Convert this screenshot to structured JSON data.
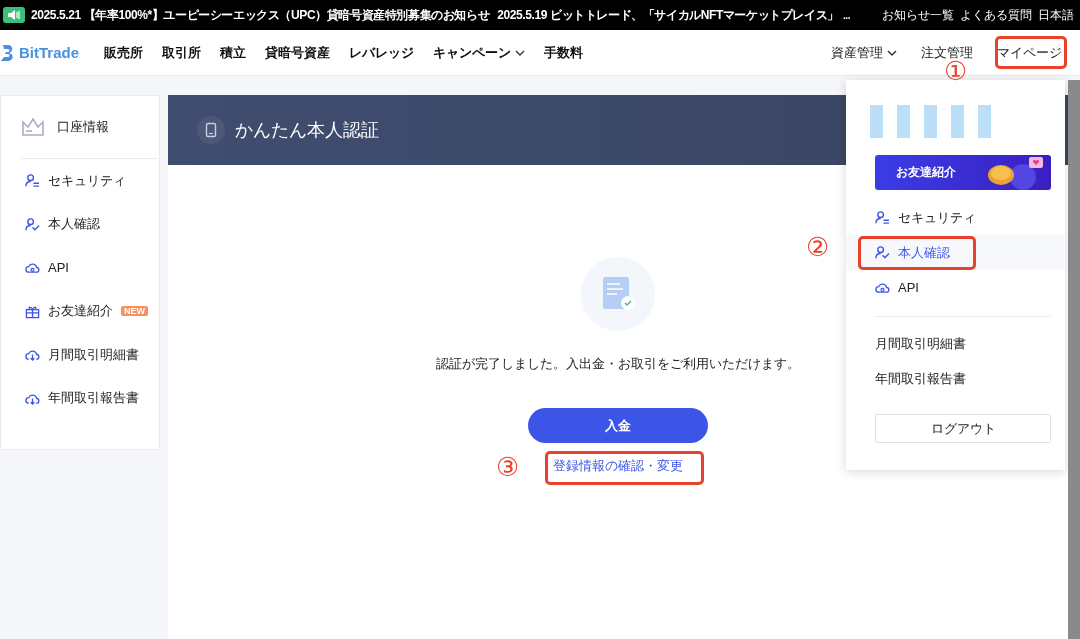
{
  "ticker": {
    "items": [
      {
        "date": "2025.5.21",
        "title": "【年率100%*】ユーピーシーエックス（UPC）貸暗号資産特別募集のお知らせ"
      },
      {
        "date": "2025.5.19",
        "title": "ビットトレード、「サイカルNFTマーケットプレイス」"
      }
    ],
    "overflow": "...",
    "links": [
      "お知らせ一覧",
      "よくある質問",
      "日本語"
    ]
  },
  "nav": {
    "logo": "BitTrade",
    "items": [
      {
        "label": "販売所",
        "dropdown": false
      },
      {
        "label": "取引所",
        "dropdown": false
      },
      {
        "label": "積立",
        "dropdown": false
      },
      {
        "label": "貸暗号資産",
        "dropdown": false
      },
      {
        "label": "レバレッジ",
        "dropdown": false
      },
      {
        "label": "キャンペーン",
        "dropdown": true
      },
      {
        "label": "手数料",
        "dropdown": false
      }
    ],
    "right": [
      {
        "label": "資産管理",
        "dropdown": true
      },
      {
        "label": "注文管理",
        "dropdown": false
      },
      {
        "label": "マイページ",
        "dropdown": false
      }
    ]
  },
  "sidebar": {
    "header": "口座情報",
    "items": [
      {
        "label": "セキュリティ",
        "kind": "security"
      },
      {
        "label": "本人確認",
        "kind": "identity"
      },
      {
        "label": "API",
        "kind": "api"
      },
      {
        "label": "お友達紹介",
        "kind": "referral",
        "badge": "NEW"
      },
      {
        "label": "月間取引明細書",
        "kind": "report"
      },
      {
        "label": "年間取引報告書",
        "kind": "report"
      }
    ]
  },
  "page": {
    "title": "かんたん本人認証",
    "message": "認証が完了しました。入出金・お取引をご利用いただけます。",
    "button": "入金",
    "link": "登録情報の確認・変更"
  },
  "dropdown": {
    "promo": "お友達紹介",
    "items": [
      {
        "label": "セキュリティ",
        "kind": "security",
        "selected": false
      },
      {
        "label": "本人確認",
        "kind": "identity",
        "selected": true
      },
      {
        "label": "API",
        "kind": "api",
        "selected": false
      }
    ],
    "reports": [
      "月間取引明細書",
      "年間取引報告書"
    ],
    "logout": "ログアウト"
  },
  "annotations": [
    {
      "number": "①"
    },
    {
      "number": "②"
    },
    {
      "number": "③"
    }
  ]
}
